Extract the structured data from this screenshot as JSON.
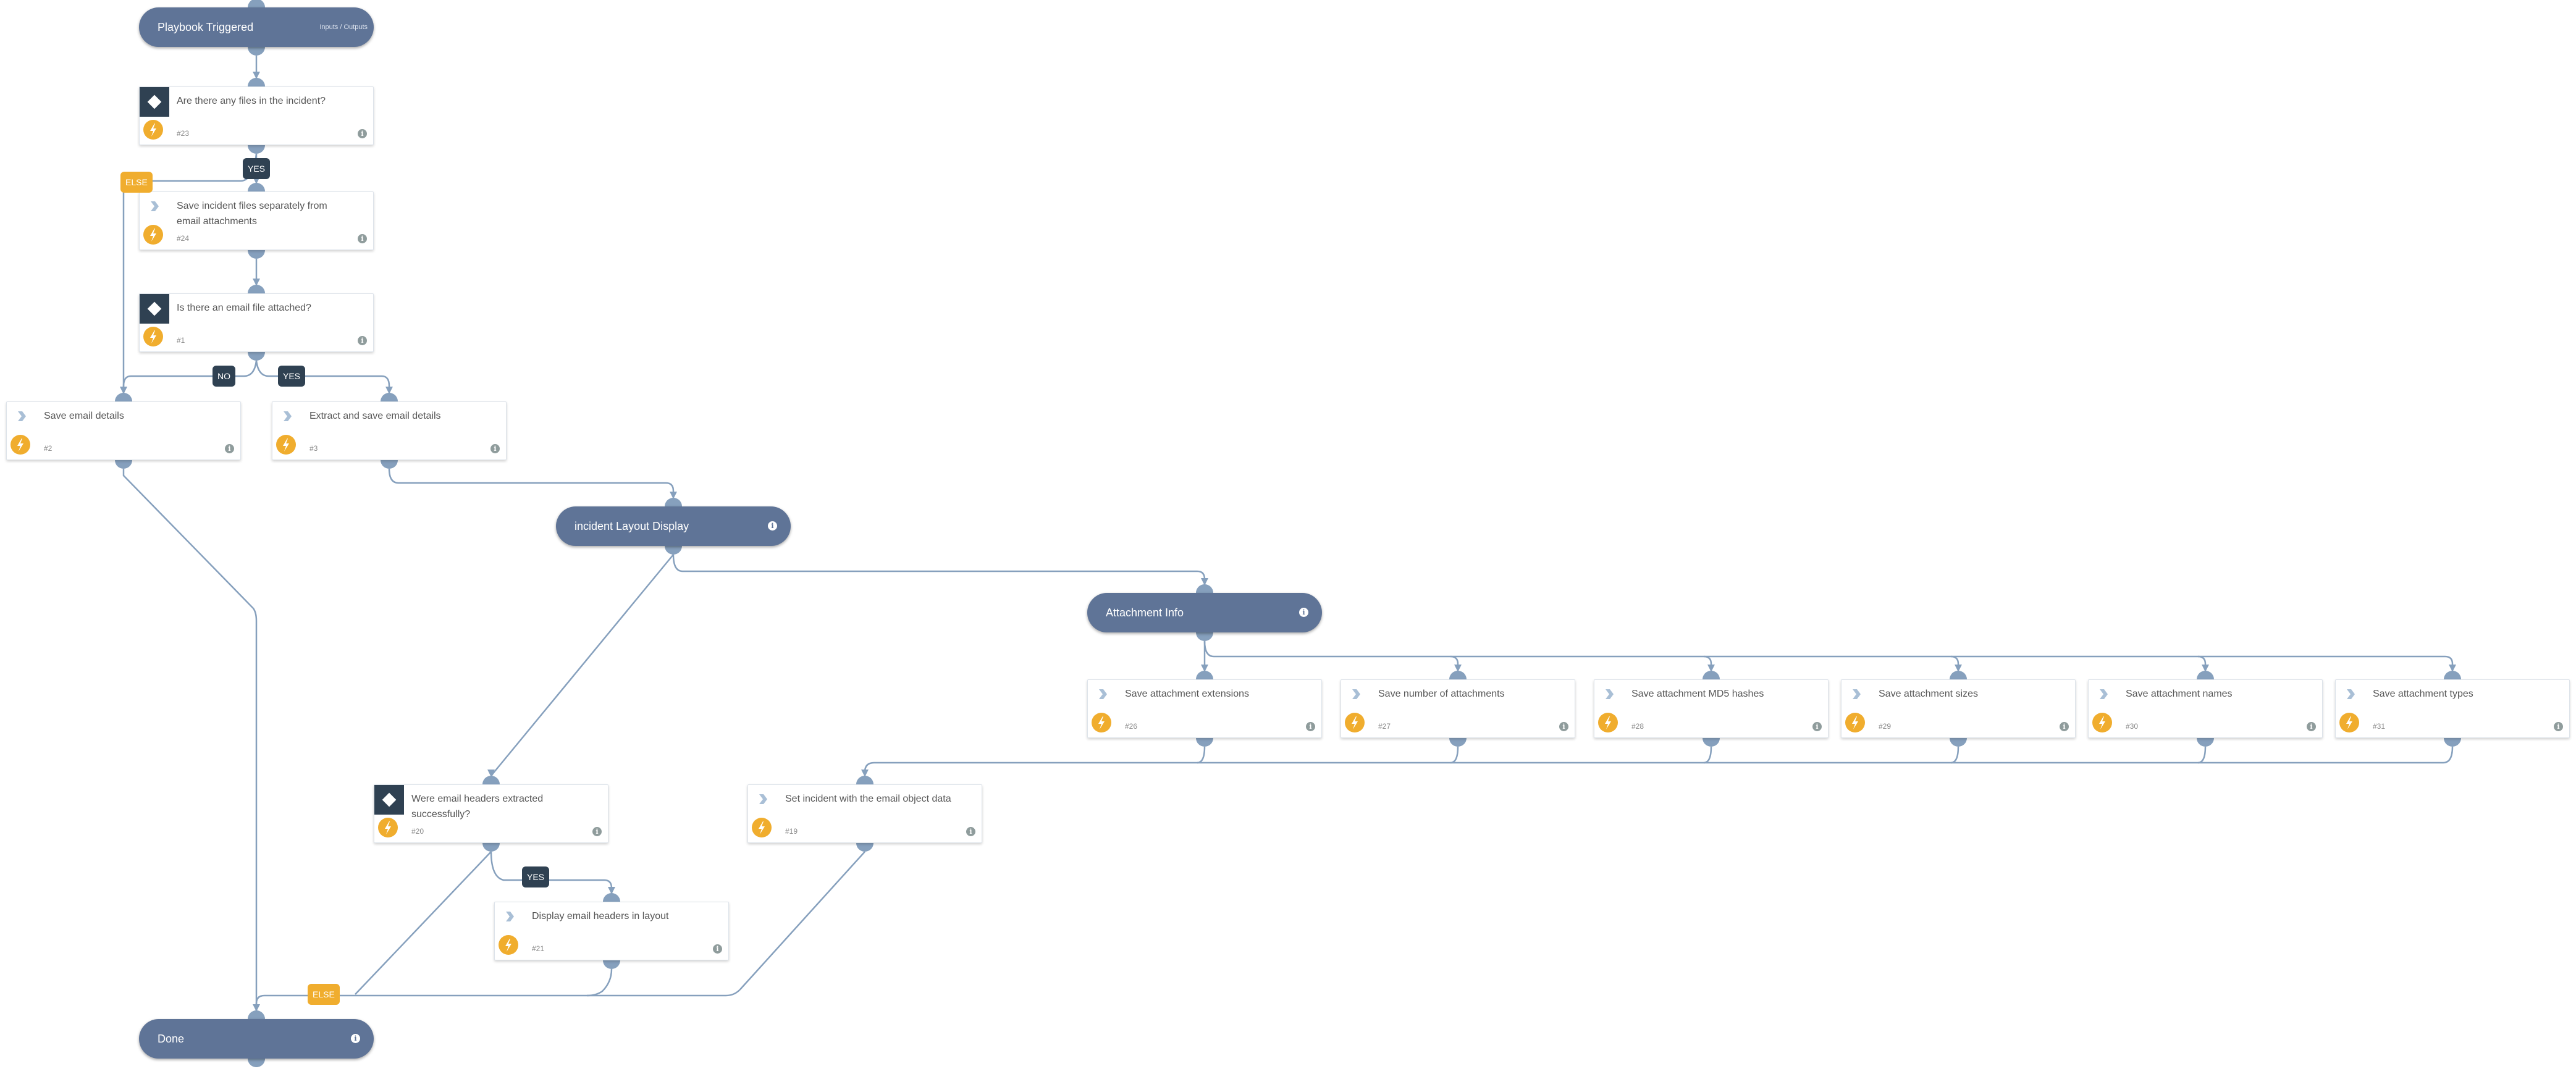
{
  "diagram": {
    "colors": {
      "pill": "#5f7497",
      "edge": "#86a0bd",
      "condition_header": "#2f4152",
      "automation_icon": "#f0ad2e",
      "else_badge": "#f0ad2e",
      "branch_badge": "#2f4152"
    },
    "start": {
      "title": "Playbook Triggered",
      "side_link": "Inputs / Outputs"
    },
    "sections": {
      "layout": {
        "title": "incident Layout Display"
      },
      "attachments": {
        "title": "Attachment Info"
      },
      "done": {
        "title": "Done"
      }
    },
    "tasks": {
      "t23": {
        "label": "Are there any files in the incident?",
        "num": "#23",
        "type": "condition"
      },
      "t24": {
        "label": "Save incident files separately from email attachments",
        "num": "#24",
        "type": "automation"
      },
      "t1": {
        "label": "Is there an email file attached?",
        "num": "#1",
        "type": "condition"
      },
      "t2": {
        "label": "Save email details",
        "num": "#2",
        "type": "automation"
      },
      "t3": {
        "label": "Extract and save email details",
        "num": "#3",
        "type": "automation"
      },
      "t26": {
        "label": "Save attachment extensions",
        "num": "#26",
        "type": "automation"
      },
      "t27": {
        "label": "Save number of attachments",
        "num": "#27",
        "type": "automation"
      },
      "t28": {
        "label": "Save attachment MD5 hashes",
        "num": "#28",
        "type": "automation"
      },
      "t29": {
        "label": "Save attachment sizes",
        "num": "#29",
        "type": "automation"
      },
      "t30": {
        "label": "Save attachment names",
        "num": "#30",
        "type": "automation"
      },
      "t31": {
        "label": "Save attachment types",
        "num": "#31",
        "type": "automation"
      },
      "t19": {
        "label": "Set incident with the email object data",
        "num": "#19",
        "type": "automation"
      },
      "t20": {
        "label": "Were email headers extracted successfully?",
        "num": "#20",
        "type": "condition"
      },
      "t21": {
        "label": "Display email headers in layout",
        "num": "#21",
        "type": "automation"
      }
    },
    "badges": {
      "b23_yes": "YES",
      "b23_else": "ELSE",
      "b1_no": "NO",
      "b1_yes": "YES",
      "b20_yes": "YES",
      "b20_else": "ELSE"
    },
    "info_glyph": "i"
  }
}
